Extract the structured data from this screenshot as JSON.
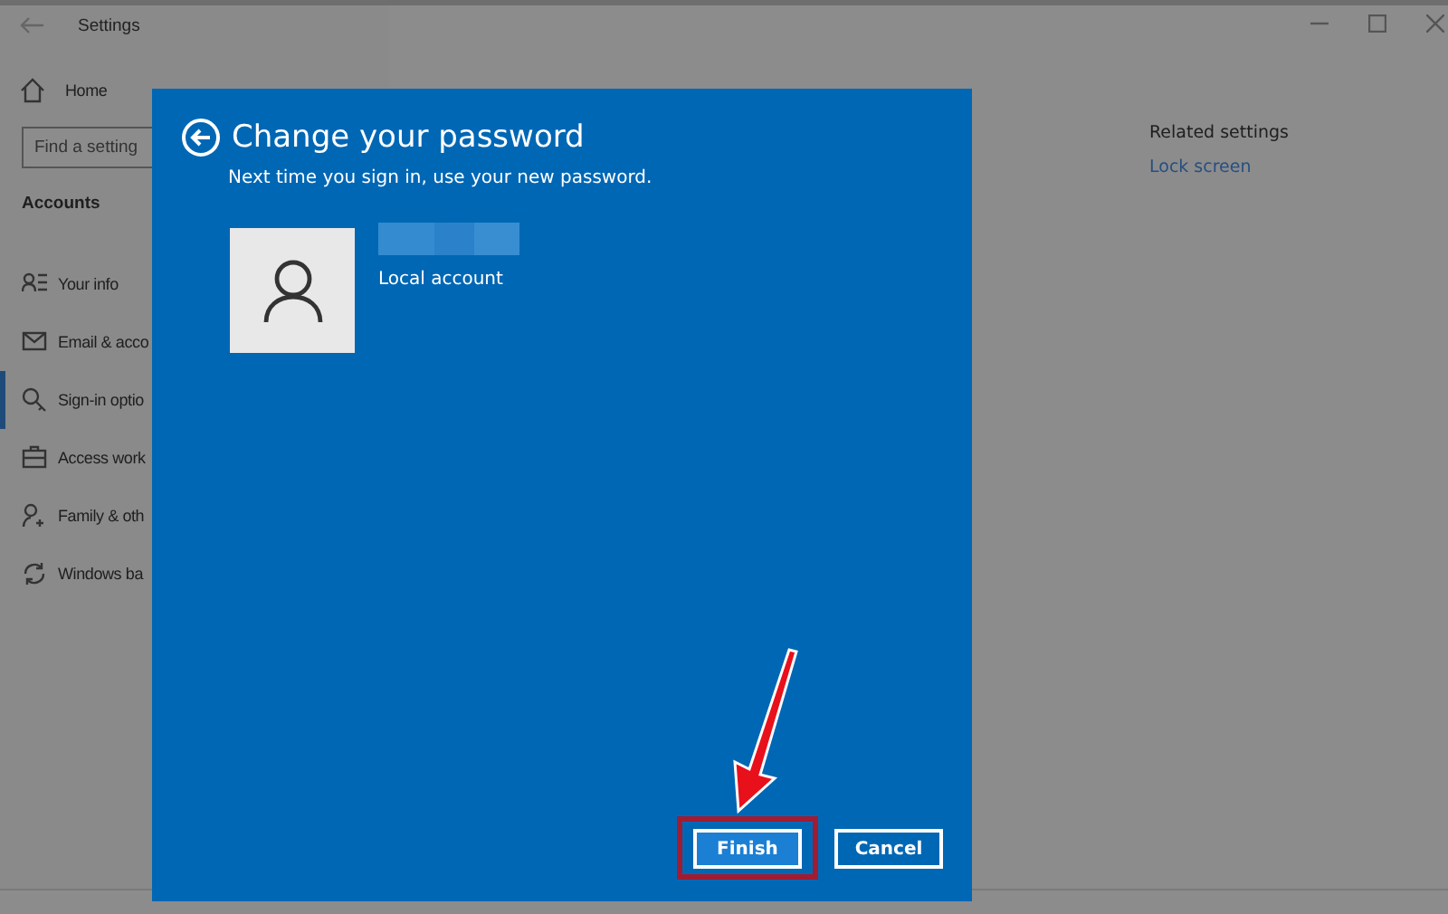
{
  "window": {
    "title": "Settings"
  },
  "sidebar": {
    "home": "Home",
    "search": {
      "placeholder": "Find a setting"
    },
    "section": "Accounts",
    "items": [
      {
        "label": "Your info",
        "selected": false
      },
      {
        "label": "Email & acco",
        "selected": false
      },
      {
        "label": "Sign-in optio",
        "selected": true
      },
      {
        "label": "Access work",
        "selected": false
      },
      {
        "label": "Family & oth",
        "selected": false
      },
      {
        "label": "Windows ba",
        "selected": false
      }
    ]
  },
  "content": {
    "related": {
      "title": "Related settings",
      "links": [
        "Lock screen"
      ]
    }
  },
  "dialog": {
    "title": "Change your password",
    "subtitle": "Next time you sign in, use your new password.",
    "account_type": "Local account",
    "buttons": [
      {
        "label": "Finish",
        "kind": "primary",
        "highlighted": true
      },
      {
        "label": "Cancel",
        "kind": "secondary",
        "highlighted": false
      }
    ]
  }
}
